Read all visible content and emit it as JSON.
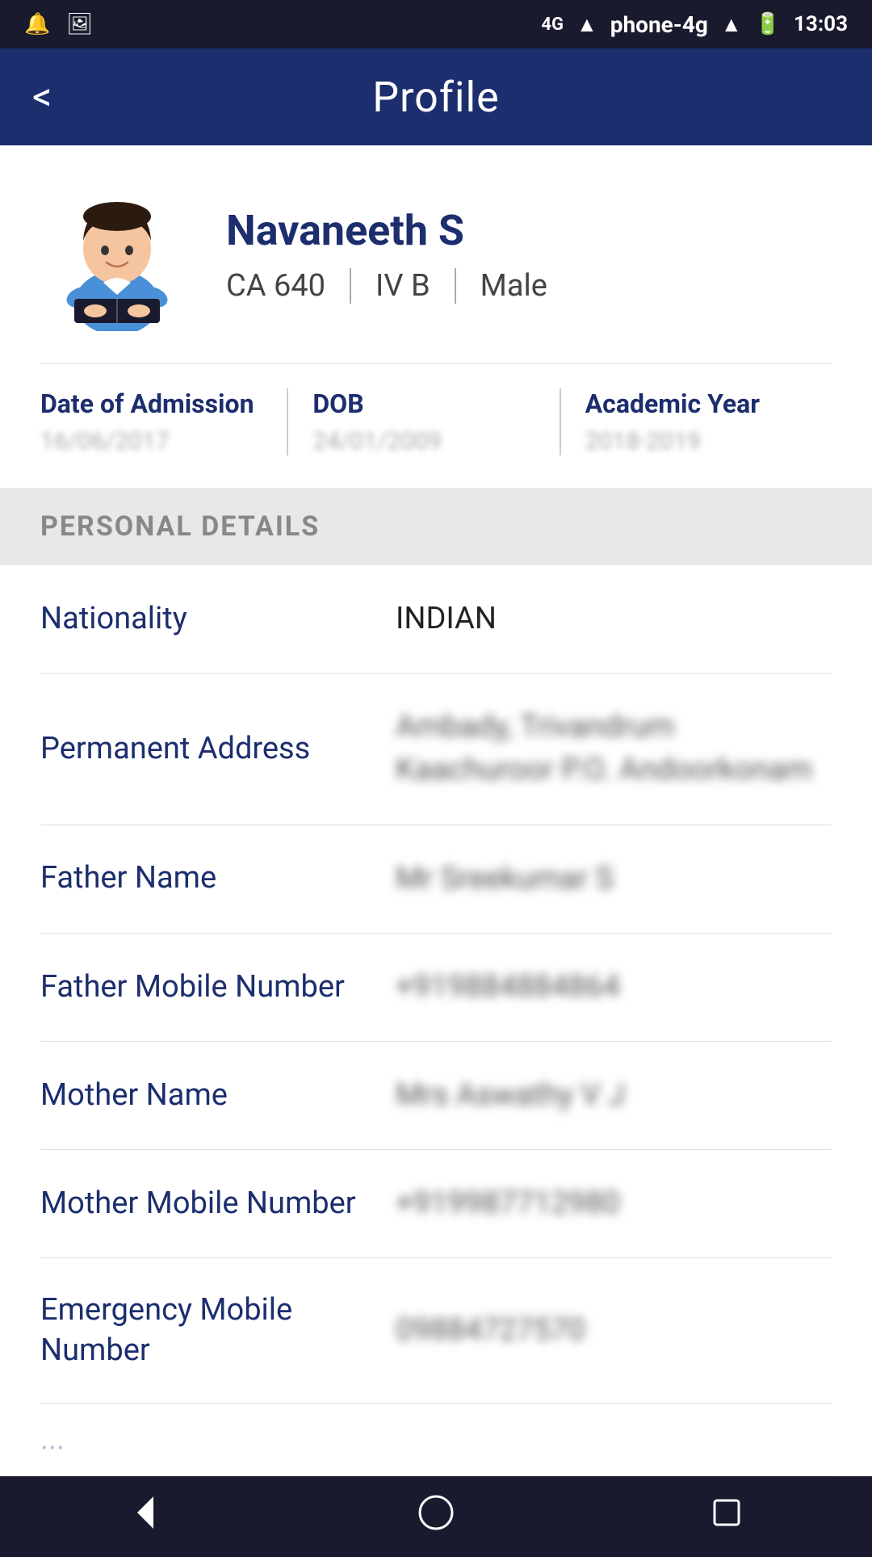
{
  "statusBar": {
    "time": "13:03",
    "icons": [
      "bell",
      "image",
      "phone-4g",
      "signal",
      "lte",
      "signal2",
      "battery"
    ]
  },
  "header": {
    "title": "Profile",
    "backLabel": "<"
  },
  "profile": {
    "name": "Navaneeth S",
    "rollNumber": "CA 640",
    "class": "IV B",
    "gender": "Male",
    "dateOfAdmission": {
      "label": "Date of Admission",
      "value": "16/06/2017"
    },
    "dob": {
      "label": "DOB",
      "value": "24/01/2009"
    },
    "academicYear": {
      "label": "Academic Year",
      "value": "2018-2019"
    }
  },
  "sections": {
    "personalDetails": {
      "heading": "PERSONAL DETAILS",
      "fields": [
        {
          "label": "Nationality",
          "value": "INDIAN",
          "blurred": false
        },
        {
          "label": "Permanent Address",
          "value": "Ambady, Trivandrum\nKaachuroor P.O.\nAndoorkonam",
          "blurred": true
        },
        {
          "label": "Father Name",
          "value": "Mr Sreekumar S",
          "blurred": true
        },
        {
          "label": "Father Mobile Number",
          "value": "+919884884864",
          "blurred": true
        },
        {
          "label": "Mother Name",
          "value": "Mrs Aswathy V J",
          "blurred": true
        },
        {
          "label": "Mother Mobile Number",
          "value": "+919987712980",
          "blurred": true
        },
        {
          "label": "Emergency Mobile Number",
          "value": "09884727570",
          "blurred": true
        }
      ]
    }
  },
  "navBar": {
    "back": "◁",
    "home": "○",
    "recent": "□"
  }
}
